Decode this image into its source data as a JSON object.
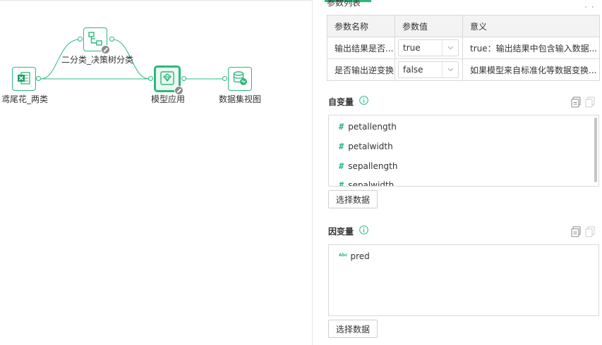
{
  "flow": {
    "nodes": [
      {
        "label": "鸢尾花_两类",
        "icon": "excel-dataset-icon"
      },
      {
        "label": "二分类_决策树分类",
        "icon": "decision-tree-icon"
      },
      {
        "label": "模型应用",
        "icon": "model-apply-icon"
      },
      {
        "label": "数据集视图",
        "icon": "database-view-icon"
      }
    ]
  },
  "panel": {
    "tab_title": "参数列表",
    "params_table": {
      "headers": [
        "参数名称",
        "参数值",
        "意义"
      ],
      "rows": [
        {
          "name": "输出结果是否...",
          "value": "true",
          "meaning": "true：输出结果中包含输入数据..."
        },
        {
          "name": "是否输出逆变换",
          "value": "false",
          "meaning": "如果模型来自标准化等数据变换..."
        }
      ]
    },
    "independent": {
      "title": "自变量",
      "items": [
        "petallength",
        "petalwidth",
        "sepallength",
        "sepalwidth"
      ],
      "button": "选择数据"
    },
    "dependent": {
      "title": "因变量",
      "items": [
        "pred"
      ],
      "button": "选择数据"
    }
  },
  "colors": {
    "accent": "#2db87d",
    "border": "#d9d9d9",
    "header_bg": "#f3f3f3"
  }
}
